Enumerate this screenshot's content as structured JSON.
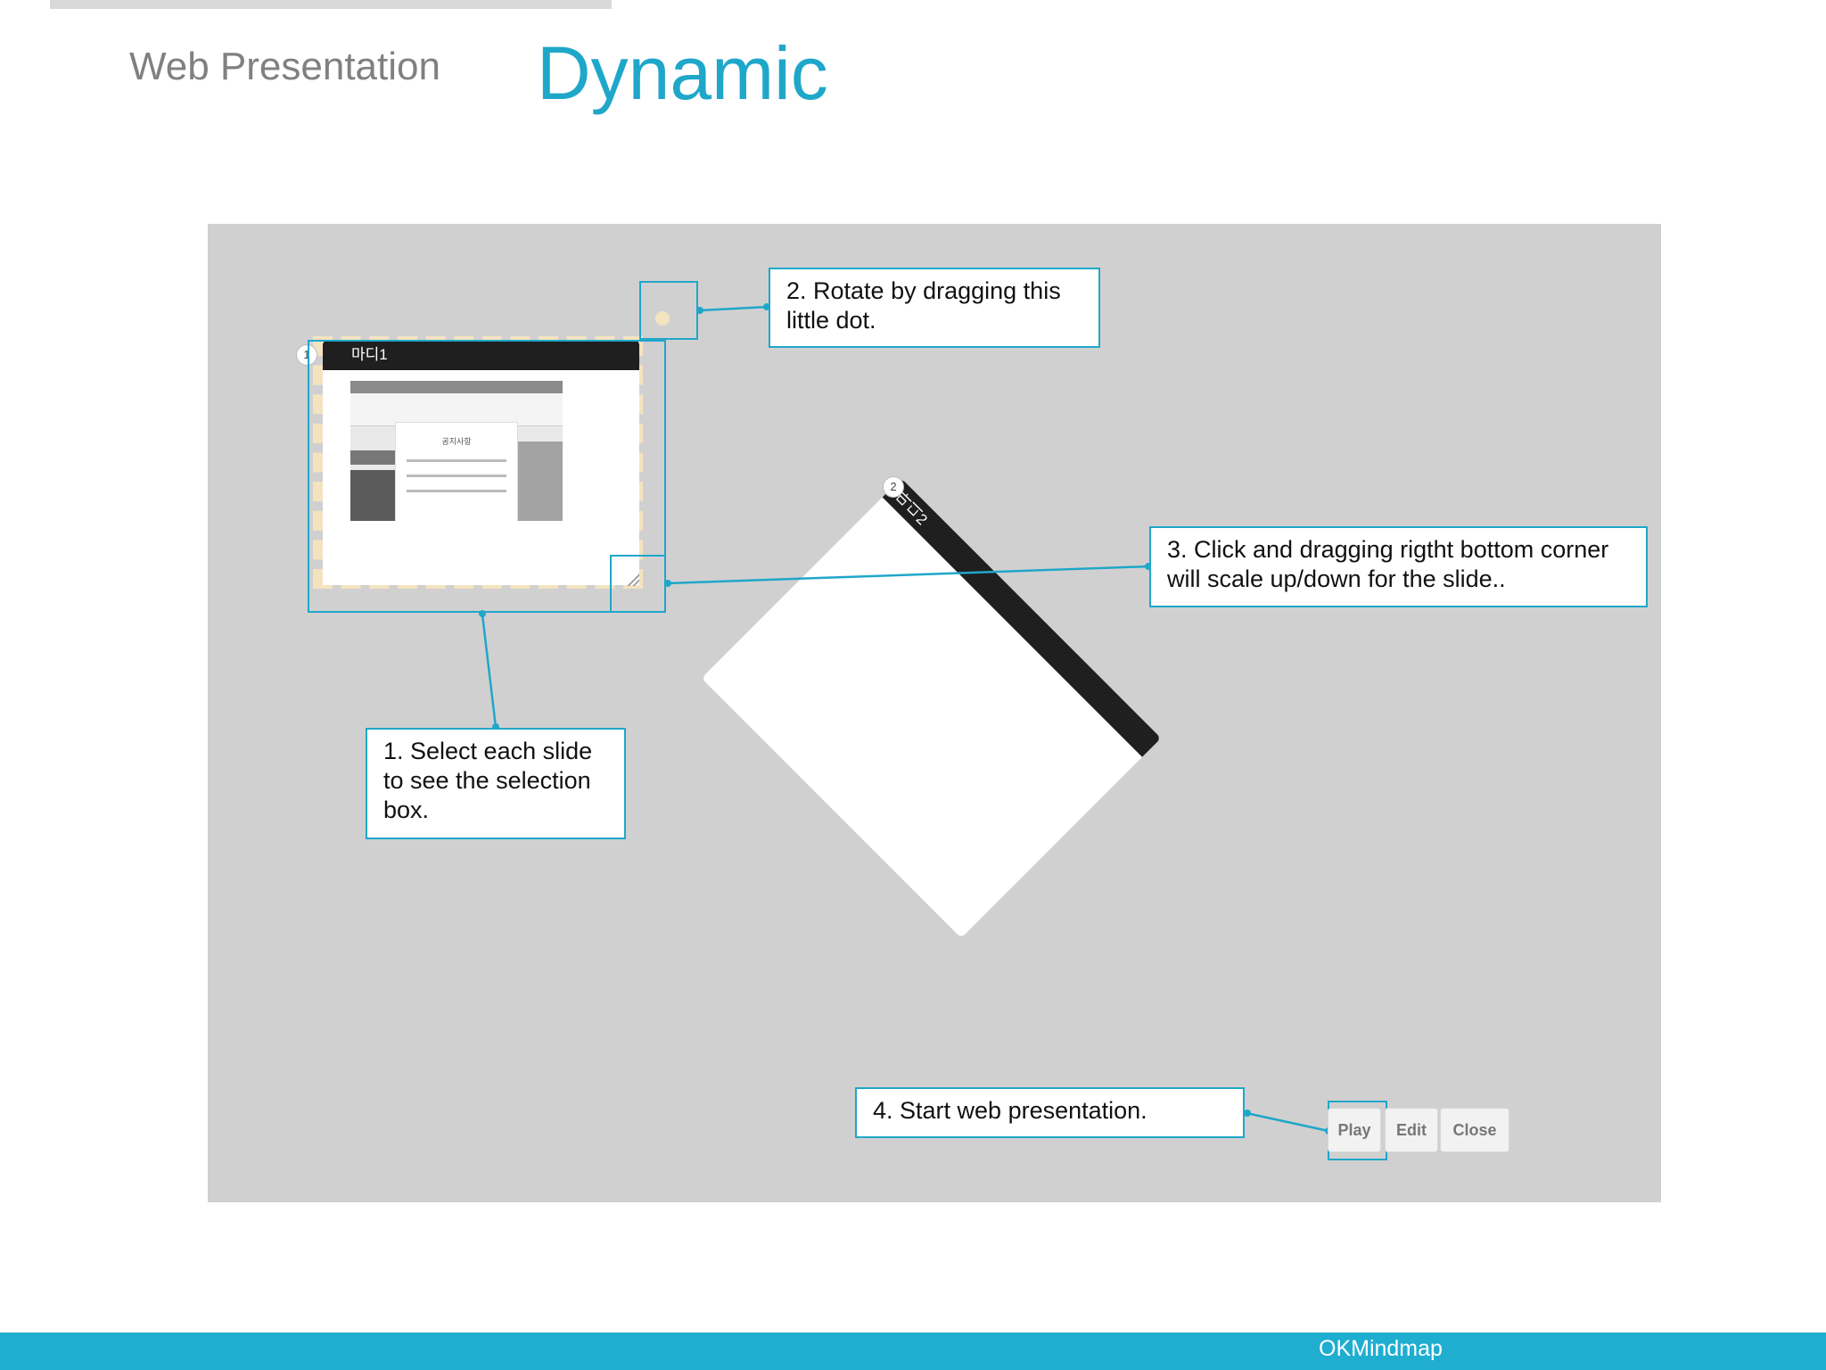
{
  "header": {
    "subtitle": "Web Presentation",
    "title": "Dynamic"
  },
  "slides": [
    {
      "badge": "1",
      "label": "마디1",
      "screenshot_dialog_title": "공지사항"
    },
    {
      "badge": "2",
      "label": "마디2"
    }
  ],
  "callouts": {
    "step1": "1. Select each slide to see the selection box.",
    "step2": "2. Rotate by dragging this little dot.",
    "step3": "3. Click and dragging rigtht bottom corner will scale up/down for the slide..",
    "step4": "4. Start web presentation."
  },
  "toolbar": {
    "play_label": "Play",
    "edit_label": "Edit",
    "close_label": "Close"
  },
  "footer": {
    "brand": "OKMindmap"
  },
  "colors": {
    "accent": "#1fa7c9",
    "footer": "#1fadd0",
    "canvas": "#d1d0d1",
    "selection": "#f3e3c0"
  }
}
